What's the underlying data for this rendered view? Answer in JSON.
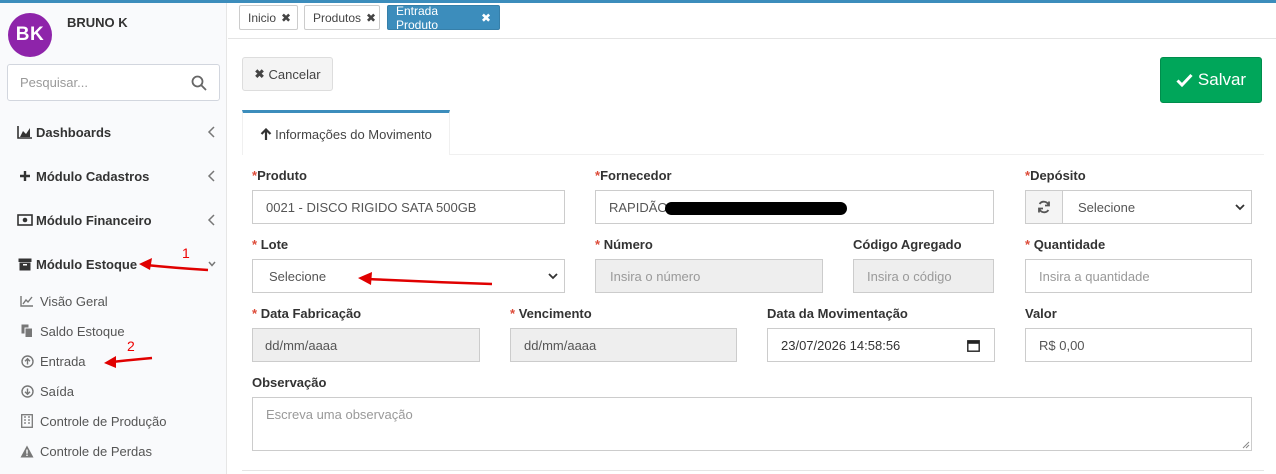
{
  "user": {
    "initials": "BK",
    "name": "BRUNO K"
  },
  "search": {
    "placeholder": "Pesquisar..."
  },
  "sidebar": {
    "menus": [
      {
        "label": "Dashboards"
      },
      {
        "label": "Módulo Cadastros"
      },
      {
        "label": "Módulo Financeiro"
      },
      {
        "label": "Módulo Estoque"
      }
    ],
    "submenus": [
      {
        "label": "Visão Geral"
      },
      {
        "label": "Saldo Estoque"
      },
      {
        "label": "Entrada"
      },
      {
        "label": "Saída"
      },
      {
        "label": "Controle de Produção"
      },
      {
        "label": "Controle de Perdas"
      }
    ]
  },
  "tabs": [
    {
      "label": "Inicio"
    },
    {
      "label": "Produtos"
    },
    {
      "label": "Entrada Produto"
    }
  ],
  "actions": {
    "cancel": "Cancelar",
    "save": "Salvar"
  },
  "section_tab": "Informações do Movimento",
  "form": {
    "produto": {
      "label": "Produto",
      "value": "0021 - DISCO RIGIDO SATA 500GB"
    },
    "fornecedor": {
      "label": "Fornecedor",
      "value": "RAPIDÃO F"
    },
    "deposito": {
      "label": "Depósito",
      "value": "Selecione"
    },
    "lote": {
      "label": "Lote",
      "value": "Selecione"
    },
    "numero": {
      "label": "Número",
      "placeholder": "Insira o número"
    },
    "codigo_agregado": {
      "label": "Código Agregado",
      "placeholder": "Insira o código"
    },
    "quantidade": {
      "label": "Quantidade",
      "placeholder": "Insira a quantidade"
    },
    "data_fabricacao": {
      "label": "Data Fabricação",
      "value": "dd/mm/aaaa"
    },
    "vencimento": {
      "label": "Vencimento",
      "value": "dd/mm/aaaa"
    },
    "data_movimentacao": {
      "label": "Data da Movimentação",
      "value": "23/07/2026 14:58:56"
    },
    "valor": {
      "label": "Valor",
      "value": "R$ 0,00"
    },
    "observacao": {
      "label": "Observação",
      "placeholder": "Escreva uma observação"
    }
  },
  "annotations": {
    "one": "1",
    "two": "2"
  },
  "colors": {
    "accent": "#3c8dbc",
    "save": "#00a65a",
    "avatar": "#8e24aa",
    "required": "#dd4b39",
    "annotation": "#e00000"
  }
}
